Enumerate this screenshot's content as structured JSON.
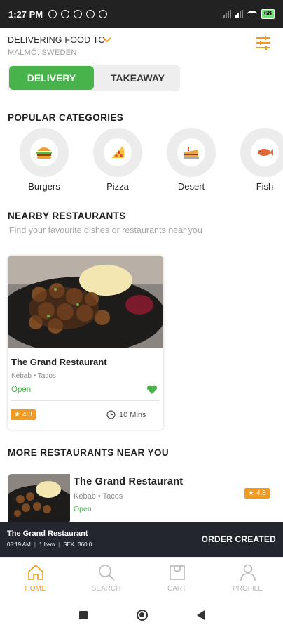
{
  "status_bar": {
    "time": "1:27 PM",
    "battery": "68"
  },
  "header": {
    "deliver_label": "DELIVERING FOOD TO",
    "location": "MALMÖ, SWEDEN"
  },
  "mode_toggle": {
    "delivery": "DELIVERY",
    "takeaway": "TAKEAWAY",
    "selected": "DELIVERY"
  },
  "categories": {
    "title": "POPULAR CATEGORIES",
    "items": [
      {
        "label": "Burgers",
        "icon": "burger-icon"
      },
      {
        "label": "Pizza",
        "icon": "pizza-icon"
      },
      {
        "label": "Desert",
        "icon": "cake-icon"
      },
      {
        "label": "Fish",
        "icon": "fish-icon"
      }
    ]
  },
  "nearby": {
    "title": "NEARBY RESTAURANTS",
    "subtitle": "Find your favourite dishes or restaurants near you",
    "card": {
      "name": "The Grand Restaurant",
      "tags": "Kebab • Tacos",
      "status": "Open",
      "rating": "4.8",
      "time": "10 Mins"
    }
  },
  "more": {
    "title": "MORE RESTAURANTS NEAR YOU",
    "item": {
      "name": "The Grand Restaurant",
      "tags": "Kebab • Tacos",
      "status": "Open",
      "rating": "4.8"
    }
  },
  "order_banner": {
    "name": "The Grand Restaurant",
    "time": "05:19 AM",
    "items": "1 Item",
    "currency": "SEK",
    "amount": "360.0",
    "status": "ORDER CREATED"
  },
  "bottom_nav": {
    "items": [
      {
        "label": "HOME",
        "icon": "home-icon",
        "active": true
      },
      {
        "label": "SEARCH",
        "icon": "search-icon",
        "active": false
      },
      {
        "label": "CART",
        "icon": "cart-icon",
        "active": false
      },
      {
        "label": "PROFILE",
        "icon": "profile-icon",
        "active": false
      }
    ]
  },
  "colors": {
    "accent": "#f19a1f",
    "green": "#47b34a",
    "banner": "#23252f"
  }
}
